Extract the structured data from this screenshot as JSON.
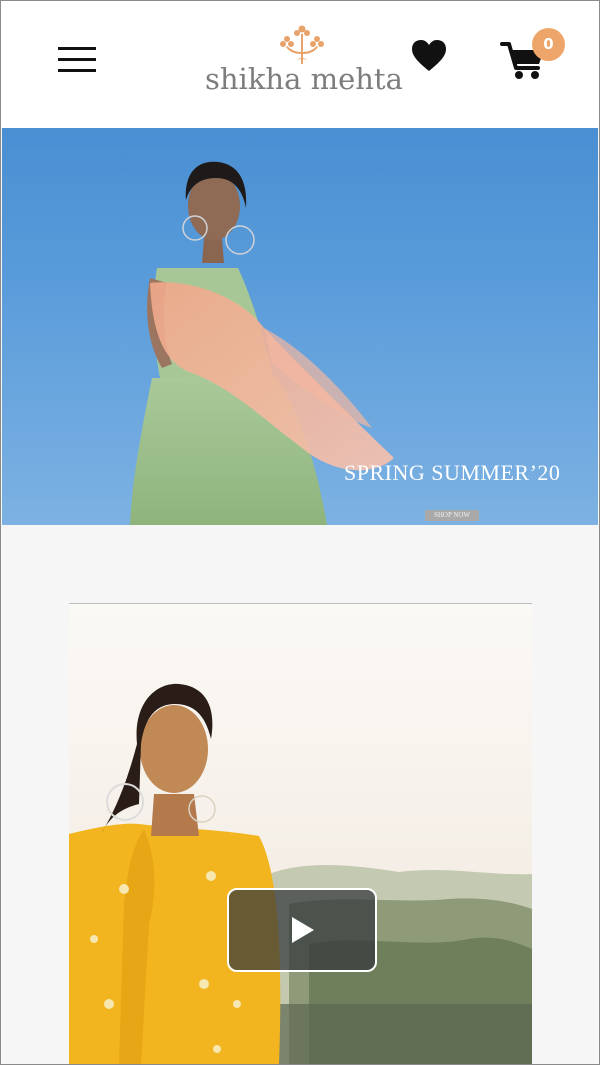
{
  "header": {
    "brand": "shikha mehta",
    "cart_count": "0"
  },
  "hero": {
    "title": "SPRING SUMMER’20",
    "cta_label": "SHOP NOW"
  },
  "icons": {
    "menu": "hamburger-menu-icon",
    "logo": "floral-motif-icon",
    "wishlist": "heart-icon",
    "cart": "shopping-cart-icon",
    "video": "play-icon"
  },
  "colors": {
    "badge": "#eda56a",
    "logo_mark": "#e8a36b",
    "brand_text": "#7d7d7d",
    "hero_sky": "#5a9cda"
  }
}
